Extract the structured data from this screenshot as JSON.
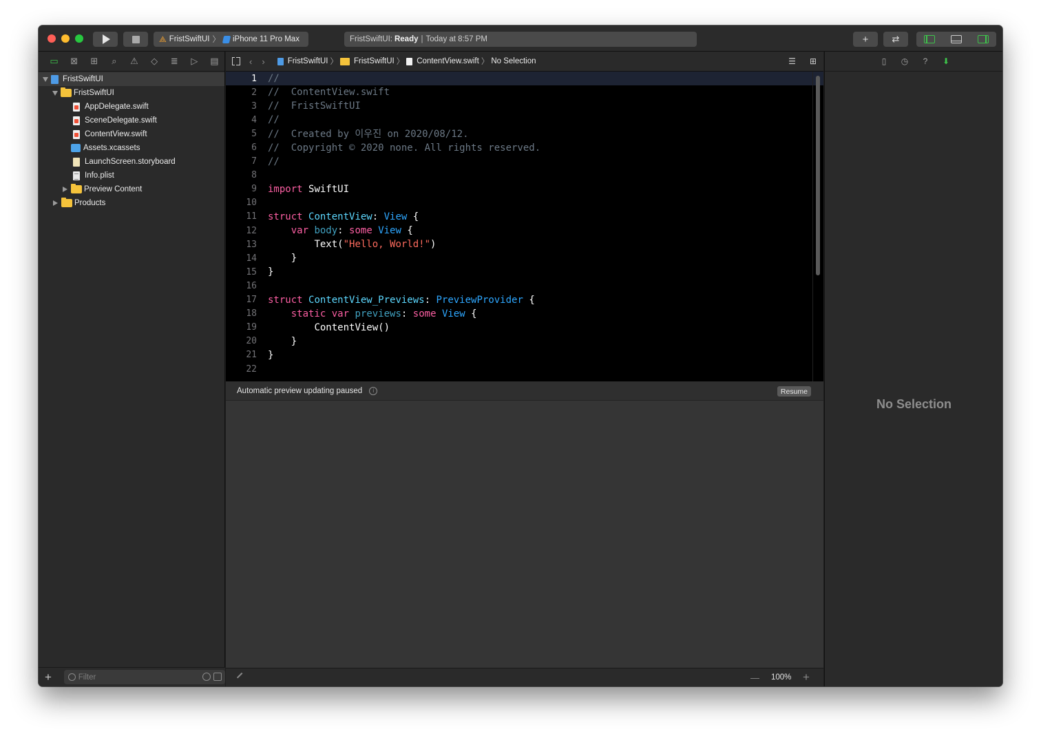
{
  "toolbar": {
    "scheme_project": "FristSwiftUI",
    "scheme_device": "iPhone 11 Pro Max",
    "activity_project": "FristSwiftUI:",
    "activity_status": "Ready",
    "activity_time": "Today at 8:57 PM",
    "plus_label": "+",
    "swap_label": "⇄"
  },
  "navigator": {
    "tree": [
      {
        "label": "FristSwiftUI",
        "kind": "project"
      },
      {
        "label": "FristSwiftUI",
        "kind": "folder"
      },
      {
        "label": "AppDelegate.swift",
        "kind": "swift"
      },
      {
        "label": "SceneDelegate.swift",
        "kind": "swift"
      },
      {
        "label": "ContentView.swift",
        "kind": "swift"
      },
      {
        "label": "Assets.xcassets",
        "kind": "assets"
      },
      {
        "label": "LaunchScreen.storyboard",
        "kind": "storyboard"
      },
      {
        "label": "Info.plist",
        "kind": "plist"
      },
      {
        "label": "Preview Content",
        "kind": "folder"
      },
      {
        "label": "Products",
        "kind": "folder"
      }
    ],
    "filter_placeholder": "Filter",
    "add_label": "+"
  },
  "jumpbar": {
    "project": "FristSwiftUI",
    "group": "FristSwiftUI",
    "file": "ContentView.swift",
    "symbol": "No Selection"
  },
  "code": {
    "line_numbers": [
      "1",
      "2",
      "3",
      "4",
      "5",
      "6",
      "7",
      "8",
      "9",
      "10",
      "11",
      "12",
      "13",
      "14",
      "15",
      "16",
      "17",
      "18",
      "19",
      "20",
      "21",
      "22"
    ],
    "comment_1": "//",
    "comment_2": "//  ContentView.swift",
    "comment_3": "//  FristSwiftUI",
    "comment_4": "//",
    "comment_5": "//  Created by 이우진 on 2020/08/12.",
    "comment_6": "//  Copyright © 2020 none. All rights reserved.",
    "comment_7": "//",
    "import_kw": "import",
    "import_module": "SwiftUI",
    "struct_kw": "struct",
    "var_kw": "var",
    "static_kw": "static",
    "some_kw": "some",
    "content_view": "ContentView",
    "view_type": "View",
    "body_prop": "body",
    "text_call": "Text(",
    "hello_str": "\"Hello, World!\"",
    "close_paren": ")",
    "previews_struct": "ContentView_Previews",
    "preview_provider": "PreviewProvider",
    "previews_prop": "previews",
    "content_view_call": "ContentView()",
    "open_brace": "{",
    "close_brace": "}",
    "colon": ":"
  },
  "preview": {
    "status": "Automatic preview updating paused",
    "info_glyph": "i",
    "resume_label": "Resume",
    "zoom": "100%",
    "zoom_minus": "—",
    "zoom_plus": "+"
  },
  "inspector": {
    "empty_label": "No Selection"
  }
}
